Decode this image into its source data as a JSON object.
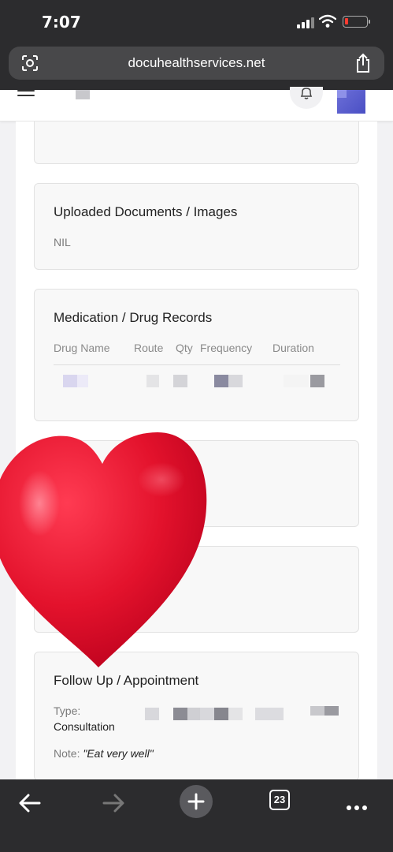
{
  "status_bar": {
    "time": "7:07"
  },
  "browser": {
    "url": "docuhealthservices.net",
    "tab_count": "23"
  },
  "sections": {
    "uploads": {
      "title": "Uploaded Documents / Images",
      "value": "NIL"
    },
    "medication": {
      "title": "Medication / Drug Records",
      "columns": [
        "Drug Name",
        "Route",
        "Qty",
        "Frequency",
        "Duration"
      ]
    },
    "follow_up": {
      "title": "Follow Up / Appointment",
      "type_label": "Type:",
      "type_value": "Consultation",
      "note_label": "Note:",
      "note_value": "\"Eat very well\""
    }
  },
  "colors": {
    "chrome": "#2c2c2e",
    "heart": "#e3122c",
    "card_bg": "#f8f8f8"
  }
}
